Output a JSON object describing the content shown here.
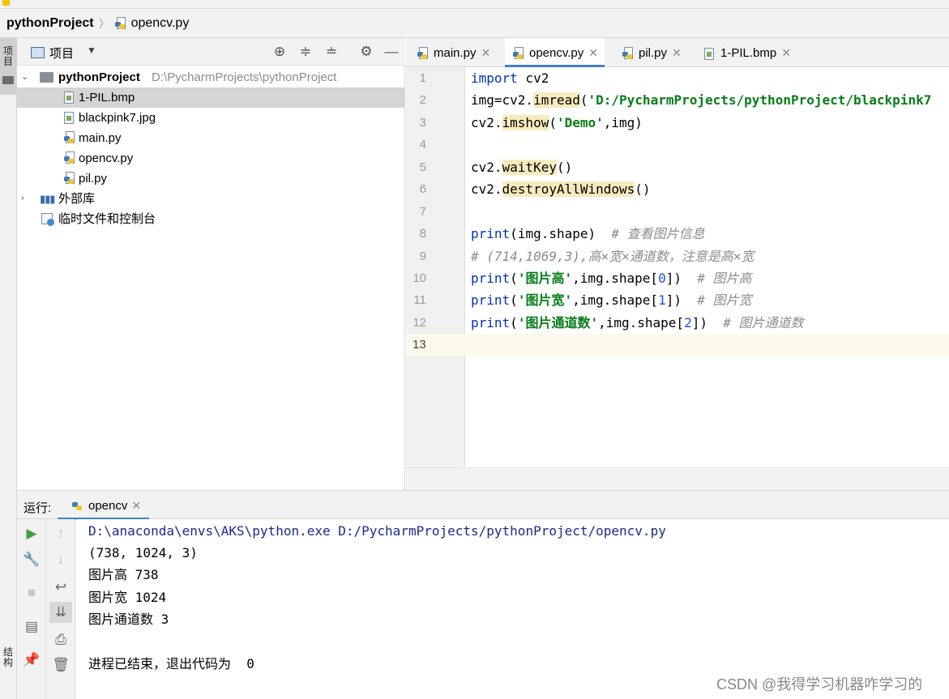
{
  "breadcrumb": {
    "project": "pythonProject",
    "file": "opencv.py"
  },
  "left_strip": {
    "project_tab": "项目",
    "structure_tab": "结构"
  },
  "project_panel": {
    "title": "项目",
    "root": {
      "name": "pythonProject",
      "path": "D:\\PycharmProjects\\pythonProject"
    },
    "files": [
      "1-PIL.bmp",
      "blackpink7.jpg",
      "main.py",
      "opencv.py",
      "pil.py"
    ],
    "external_libs": "外部库",
    "scratches": "临时文件和控制台"
  },
  "editor": {
    "tabs": [
      "main.py",
      "opencv.py",
      "pil.py",
      "1-PIL.bmp"
    ],
    "active_tab": "opencv.py",
    "line_numbers": [
      "1",
      "2",
      "3",
      "4",
      "5",
      "6",
      "7",
      "8",
      "9",
      "10",
      "11",
      "12",
      "13"
    ],
    "current_line": 13,
    "code": {
      "l1_kw": "import",
      "l1_rest": " cv2",
      "l2_pre": "img=cv2.",
      "l2_fn": "imread",
      "l2_open": "(",
      "l2_str": "'D:/PycharmProjects/pythonProject/blackpink7",
      "l3_pre": "cv2.",
      "l3_fn": "imshow",
      "l3_open": "(",
      "l3_str": "'Demo'",
      "l3_rest": ",img)",
      "l5_pre": "cv2.",
      "l5_fn": "waitKey",
      "l5_rest": "()",
      "l6_pre": "cv2.",
      "l6_fn": "destroyAllWindows",
      "l6_rest": "()",
      "l8_kw": "print",
      "l8_rest": "(img.shape)  ",
      "l8_cmt": "# 查看图片信息",
      "l9_cmt": "# (714,1069,3),高×宽×通道数，注意是高×宽",
      "l10_kw": "print",
      "l10_open": "(",
      "l10_str": "'图片高'",
      "l10_mid": ",img.shape[",
      "l10_num": "0",
      "l10_close": "])  ",
      "l10_cmt": "# 图片高",
      "l11_kw": "print",
      "l11_open": "(",
      "l11_str": "'图片宽'",
      "l11_mid": ",img.shape[",
      "l11_num": "1",
      "l11_close": "])  ",
      "l11_cmt": "# 图片宽",
      "l12_kw": "print",
      "l12_open": "(",
      "l12_str": "'图片通道数'",
      "l12_mid": ",img.shape[",
      "l12_num": "2",
      "l12_close": "])  ",
      "l12_cmt": "# 图片通道数"
    }
  },
  "run_panel": {
    "label": "运行:",
    "tab": "opencv",
    "output": {
      "cmd": "D:\\anaconda\\envs\\AKS\\python.exe D:/PycharmProjects/pythonProject/opencv.py",
      "shape": "(738, 1024, 3)",
      "height": "图片高 738",
      "width": "图片宽 1024",
      "channels": "图片通道数 3",
      "exit": "进程已结束，退出代码为  0"
    }
  },
  "watermark": "CSDN @我得学习机器咋学习的"
}
